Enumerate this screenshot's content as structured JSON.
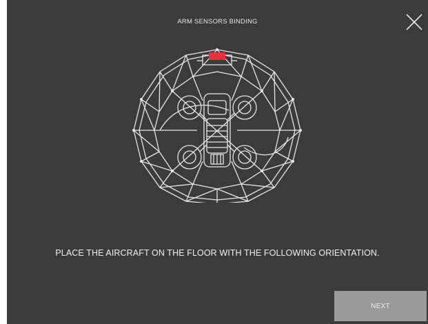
{
  "header": {
    "title": "ARM SENSORS BINDING"
  },
  "main": {
    "illustration_icon": "drone-cage-icon",
    "instruction": "PLACE THE AIRCRAFT ON THE FLOOR WITH THE FOLLOWING ORIENTATION."
  },
  "footer": {
    "next_label": "NEXT"
  },
  "icons": {
    "close": "close-icon"
  },
  "colors": {
    "background": "#3b3b3b",
    "text": "#f0f0f0",
    "line_art": "#e8e8e8",
    "accent_marker": "#e8313c",
    "next_button": "#9a9a9a"
  }
}
